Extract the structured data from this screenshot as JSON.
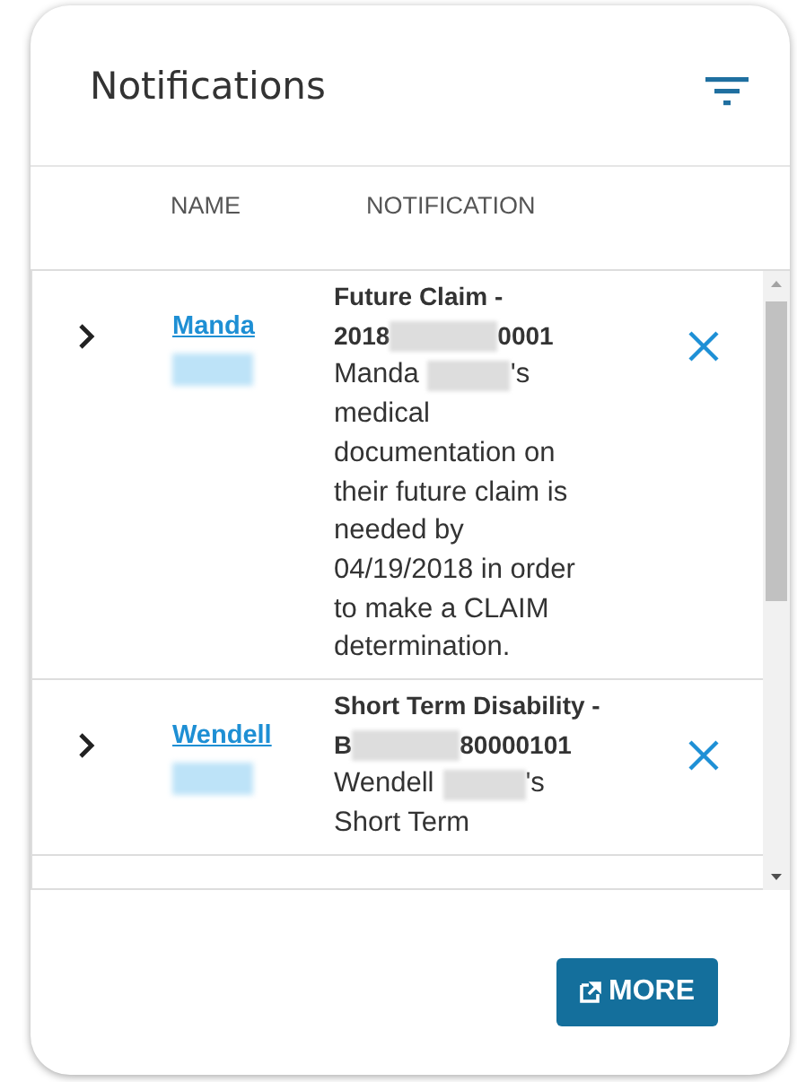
{
  "title": "Notifications",
  "columns": [
    "NAME",
    "NOTIFICATION"
  ],
  "rows": [
    {
      "name": "Manda",
      "title": "Future Claim -",
      "id_before": "2018",
      "id_after": "0001",
      "body_name": "Manda",
      "body_possessive": "'s",
      "body": "medical documentation on their future claim is needed by 04/19/2018 in order to make a CLAIM determination."
    },
    {
      "name": "Wendell",
      "title": "Short Term Disability -",
      "id_before": "B",
      "id_after": "80000101",
      "body_name": "Wendell",
      "body_possessive": "'s",
      "body": "Short Term"
    }
  ],
  "more_button": "MORE"
}
